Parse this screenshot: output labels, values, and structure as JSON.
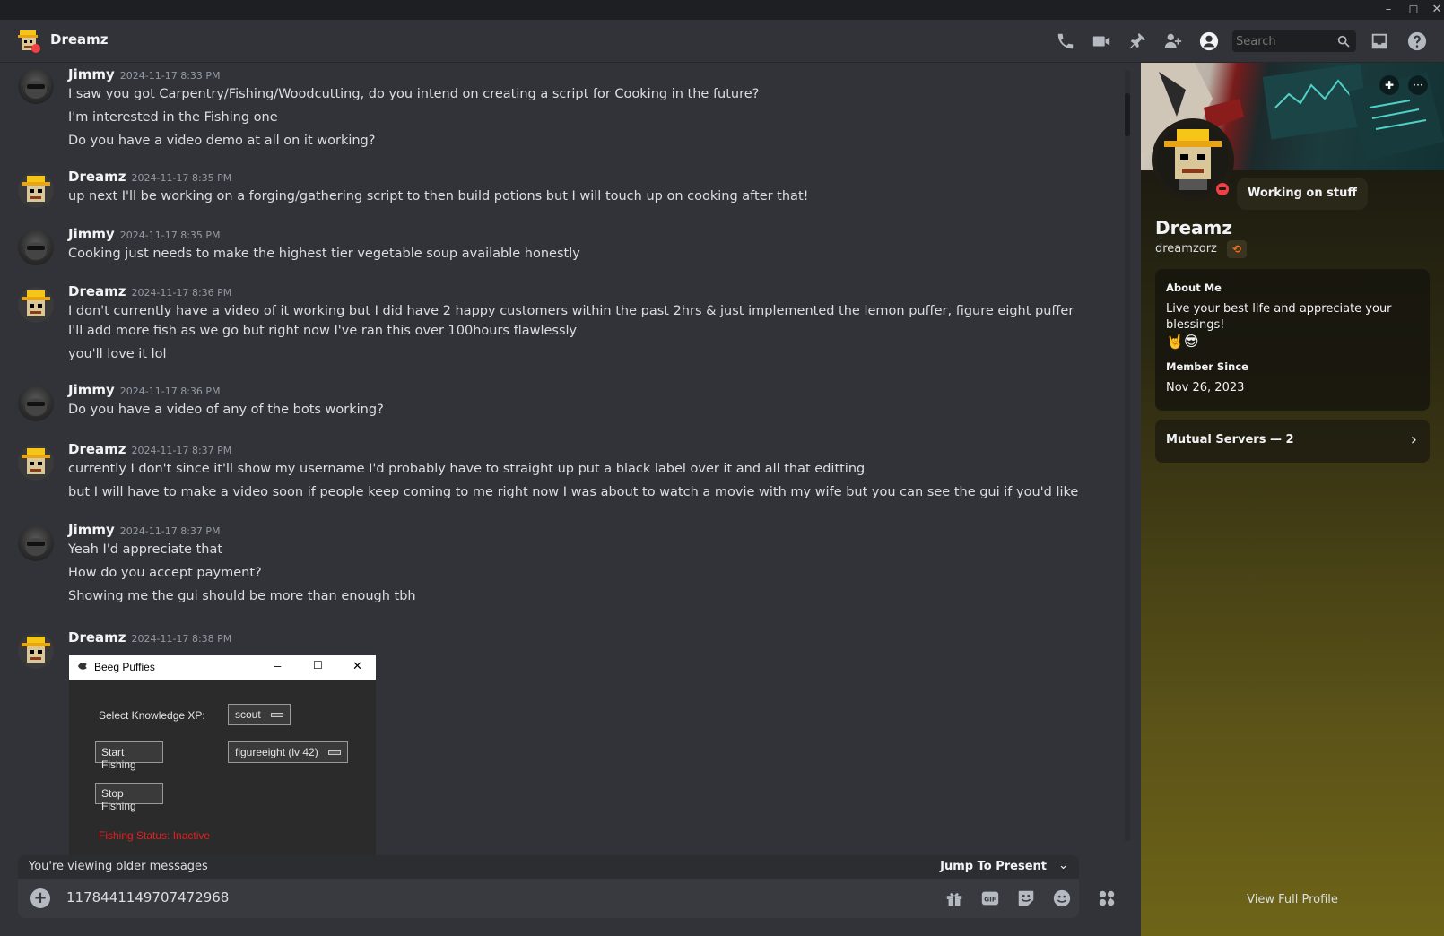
{
  "window": {
    "minimize": "–",
    "maximize": "☐",
    "close": "✕"
  },
  "header": {
    "title": "Dreamz",
    "search_placeholder": "Search"
  },
  "messages": [
    {
      "author": "Jimmy",
      "timestamp": "2024-11-17 8:33 PM",
      "avatar": "jimmy",
      "lines": [
        "I saw you got Carpentry/Fishing/Woodcutting, do you intend on creating a script for Cooking in the future?",
        "I'm interested in the Fishing one",
        "Do you have a video demo at all on it working?"
      ]
    },
    {
      "author": "Dreamz",
      "timestamp": "2024-11-17 8:35 PM",
      "avatar": "dreamz",
      "lines": [
        "up next I'll be working on a forging/gathering script to then build potions but I will touch up on cooking after that!"
      ]
    },
    {
      "author": "Jimmy",
      "timestamp": "2024-11-17 8:35 PM",
      "avatar": "jimmy",
      "lines": [
        "Cooking just needs to make the highest tier vegetable soup available honestly"
      ]
    },
    {
      "author": "Dreamz",
      "timestamp": "2024-11-17 8:36 PM",
      "avatar": "dreamz",
      "lines": [
        "I don't currently have a video of it working but I did have 2 happy customers within the past 2hrs & just implemented the lemon puffer, figure eight puffer I'll add more fish as we go but right now I've ran this over 100hours flawlessly",
        "you'll love it lol"
      ]
    },
    {
      "author": "Jimmy",
      "timestamp": "2024-11-17 8:36 PM",
      "avatar": "jimmy",
      "lines": [
        "Do you have a video of any of the bots working?"
      ]
    },
    {
      "author": "Dreamz",
      "timestamp": "2024-11-17 8:37 PM",
      "avatar": "dreamz",
      "lines": [
        "currently I don't since it'll show my username I'd probably have to straight up put a black label over it and all that editting",
        "but I will have to make a video soon if people keep coming to me right now I was about to watch a movie with my wife but you can see the gui if you'd like"
      ]
    },
    {
      "author": "Jimmy",
      "timestamp": "2024-11-17 8:37 PM",
      "avatar": "jimmy",
      "lines": [
        "Yeah I'd appreciate that",
        "How do you accept payment?",
        "Showing me the gui should be more than enough tbh"
      ]
    },
    {
      "author": "Dreamz",
      "timestamp": "2024-11-17 8:38 PM",
      "avatar": "dreamz",
      "lines": []
    }
  ],
  "embed": {
    "window_title": "Beeg Puffies",
    "select_label": "Select Knowledge XP:",
    "select_value": "scout",
    "start_button": "Start Fishing",
    "fish_value": "figureeight (lv 42)",
    "stop_button": "Stop Fishing",
    "status": "Fishing Status: Inactive"
  },
  "older_bar": {
    "text": "You're viewing older messages",
    "jump": "Jump To Present",
    "chevron": "⌄"
  },
  "composer": {
    "value": "1178441149707472968",
    "plus": "+"
  },
  "profile": {
    "status": "Working on stuff",
    "name": "Dreamz",
    "username": "dreamzorz",
    "about_title": "About Me",
    "about_text": "Live your best life and appreciate your blessings!",
    "about_emoji": "🤘😎",
    "member_since_title": "Member Since",
    "member_since": "Nov 26, 2023",
    "mutual_servers": "Mutual Servers — 2",
    "view_full": "View Full Profile",
    "more": "···"
  },
  "colors": {
    "background": "#313338",
    "accent_dnd": "#f23f43",
    "status_red": "#e02020"
  }
}
